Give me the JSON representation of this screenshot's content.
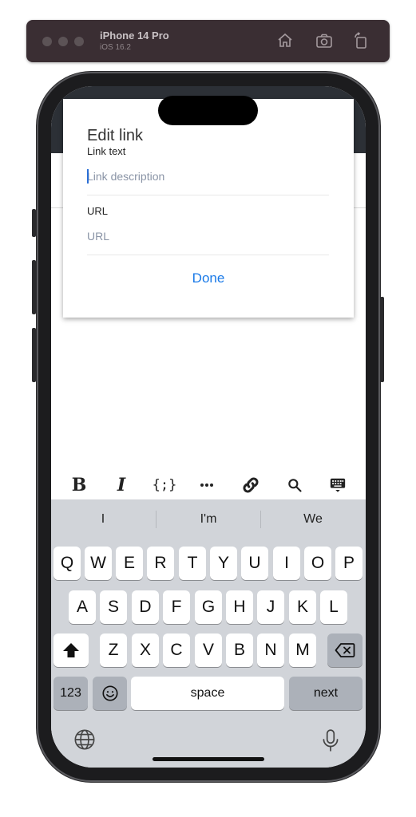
{
  "simulator": {
    "device_name": "iPhone 14 Pro",
    "os_version": "iOS 16.2",
    "buttons": [
      "home-icon",
      "screenshot-icon",
      "rotate-icon"
    ]
  },
  "dialog": {
    "title": "Edit link",
    "link_text_label": "Link text",
    "link_text_placeholder": "Link description",
    "link_text_value": "",
    "url_label": "URL",
    "url_placeholder": "URL",
    "url_value": "",
    "done_label": "Done",
    "accent_color": "#1a7ae8"
  },
  "toolbar": {
    "bold_label": "B",
    "italic_label": "I",
    "code_label": "{;}",
    "items": [
      "bold-icon",
      "italic-icon",
      "code-icon",
      "more-icon",
      "link-icon",
      "search-icon",
      "keyboard-hide-icon"
    ]
  },
  "keyboard": {
    "suggestions": [
      "I",
      "I'm",
      "We"
    ],
    "row1": [
      "Q",
      "W",
      "E",
      "R",
      "T",
      "Y",
      "U",
      "I",
      "O",
      "P"
    ],
    "row2": [
      "A",
      "S",
      "D",
      "F",
      "G",
      "H",
      "J",
      "K",
      "L"
    ],
    "row3": [
      "Z",
      "X",
      "C",
      "V",
      "B",
      "N",
      "M"
    ],
    "numbers_label": "123",
    "space_label": "space",
    "return_label": "next"
  }
}
